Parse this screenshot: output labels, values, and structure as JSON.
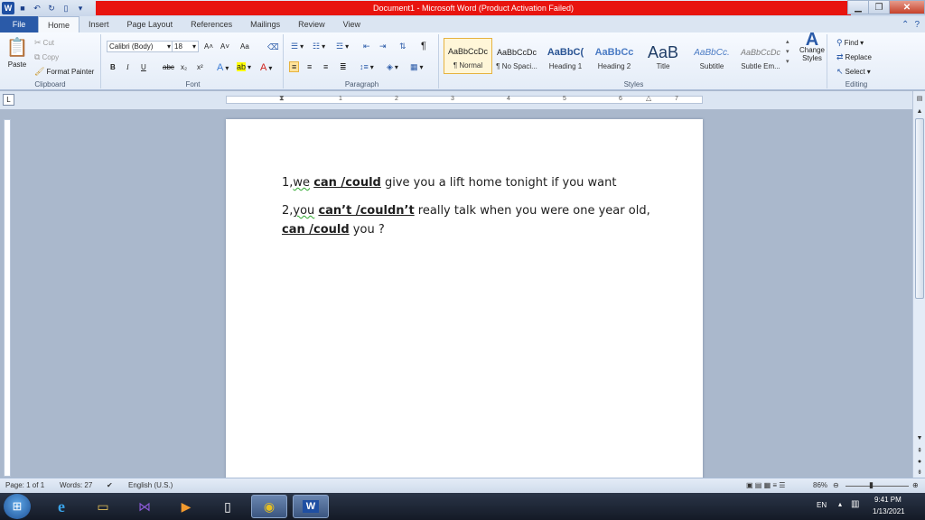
{
  "window": {
    "title": "Document1 - Microsoft Word (Product Activation Failed)",
    "word_logo_letter": "W",
    "minimize": "▁",
    "restore": "❐",
    "close": "✕"
  },
  "tabs": {
    "file": "File",
    "home": "Home",
    "insert": "Insert",
    "page_layout": "Page Layout",
    "references": "References",
    "mailings": "Mailings",
    "review": "Review",
    "view": "View"
  },
  "ribbon": {
    "clipboard": {
      "label": "Clipboard",
      "paste": "Paste",
      "cut": "Cut",
      "copy": "Copy",
      "format_painter": "Format Painter"
    },
    "font": {
      "label": "Font",
      "font_name": "Calibri (Body)",
      "font_size": "18",
      "bold": "B",
      "italic": "I",
      "underline": "U",
      "strike": "abc",
      "subscript": "x₂",
      "superscript": "x²",
      "grow": "A˄",
      "shrink": "A˅",
      "change_case": "Aa"
    },
    "paragraph": {
      "label": "Paragraph",
      "pilcrow": "¶"
    },
    "styles": {
      "label": "Styles",
      "items": [
        {
          "sample": "AaBbCcDc",
          "name": "¶ Normal"
        },
        {
          "sample": "AaBbCcDc",
          "name": "¶ No Spaci..."
        },
        {
          "sample": "AaBbC(",
          "name": "Heading 1"
        },
        {
          "sample": "AaBbCc",
          "name": "Heading 2"
        },
        {
          "sample": "AaB",
          "name": "Title"
        },
        {
          "sample": "AaBbCc.",
          "name": "Subtitle"
        },
        {
          "sample": "AaBbCcDc",
          "name": "Subtle Em..."
        }
      ],
      "change_styles": "Change Styles"
    },
    "editing": {
      "label": "Editing",
      "find": "Find",
      "replace": "Replace",
      "select": "Select"
    }
  },
  "ruler": {
    "numbers": [
      "1",
      "1",
      "2",
      "3",
      "4",
      "5",
      "6",
      "7"
    ]
  },
  "document": {
    "line1": {
      "pre": "1,",
      "sq": "we",
      "sp": " ",
      "bold": "can /could",
      "post": " give you a lift home tonight if you want"
    },
    "line2": {
      "pre": "2,",
      "sq": "you",
      "sp": " ",
      "bold": "can’t /couldn’t",
      "post": " really talk when you were  one year old,"
    },
    "line3": {
      "bold": "can /could",
      "post": " you ?"
    }
  },
  "status": {
    "page": "Page: 1 of 1",
    "words": "Words: 27",
    "language": "English (U.S.)",
    "zoom": "86%"
  },
  "taskbar": {
    "lang": "EN",
    "time": "9:41 PM",
    "date": "1/13/2021"
  }
}
